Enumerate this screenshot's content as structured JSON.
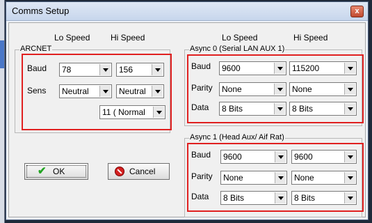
{
  "window": {
    "title": "Comms Setup",
    "close_glyph": "x"
  },
  "left": {
    "col_lo": "Lo Speed",
    "col_hi": "Hi Speed",
    "group": "ARCNET",
    "baud_label": "Baud",
    "sens_label": "Sens",
    "baud_lo": "78",
    "baud_hi": "156",
    "sens_lo": "Neutral",
    "sens_hi": "Neutral",
    "mode": "11 ( Normal"
  },
  "right": {
    "col_lo": "Lo Speed",
    "col_hi": "Hi Speed",
    "async0": {
      "group": "Async 0 (Serial LAN AUX 1)",
      "baud_label": "Baud",
      "parity_label": "Parity",
      "data_label": "Data",
      "baud_lo": "9600",
      "baud_hi": "115200",
      "parity_lo": "None",
      "parity_hi": "None",
      "data_lo": "8 Bits",
      "data_hi": "8 Bits"
    },
    "async1": {
      "group": "Async 1 (Head Aux/ Aif Rat)",
      "baud_label": "Baud",
      "parity_label": "Parity",
      "data_label": "Data",
      "baud_lo": "9600",
      "baud_hi": "9600",
      "parity_lo": "None",
      "parity_hi": "None",
      "data_lo": "8 Bits",
      "data_hi": "8 Bits"
    }
  },
  "buttons": {
    "ok": "OK",
    "cancel": "Cancel"
  },
  "icons": {
    "ok": "checkmark-icon",
    "cancel": "stop-icon",
    "close": "close-icon"
  },
  "colors": {
    "highlight": "#e02020",
    "ok_check": "#22a422",
    "cancel_icon": "#d42020"
  }
}
